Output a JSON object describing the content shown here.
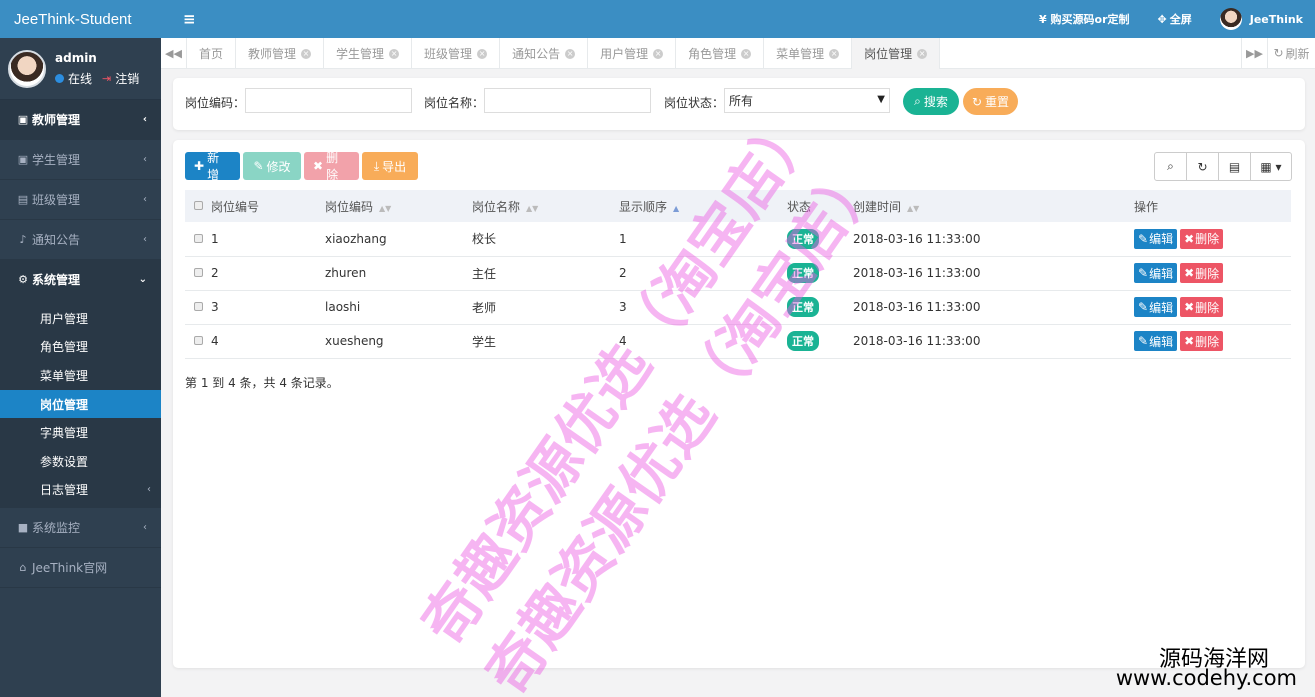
{
  "brand": "JeeThink-Student",
  "user": {
    "name": "admin",
    "status": "在线",
    "logout": "注销"
  },
  "sidebar": {
    "items": [
      {
        "label": "教师管理",
        "icon": "id-card-icon"
      },
      {
        "label": "学生管理",
        "icon": "id-card-icon"
      },
      {
        "label": "班级管理",
        "icon": "address-card-icon"
      },
      {
        "label": "通知公告",
        "icon": "bell-icon"
      },
      {
        "label": "系统管理",
        "icon": "gear-icon"
      }
    ],
    "submenu": [
      "用户管理",
      "角色管理",
      "菜单管理",
      "岗位管理",
      "字典管理",
      "参数设置",
      "日志管理"
    ],
    "monitor": "系统监控",
    "site": "JeeThink官网"
  },
  "topbar": {
    "buy": "¥ 购买源码or定制",
    "fullscreen": "全屏",
    "username": "JeeThink"
  },
  "tabs": [
    "首页",
    "教师管理",
    "学生管理",
    "班级管理",
    "通知公告",
    "用户管理",
    "角色管理",
    "菜单管理",
    "岗位管理"
  ],
  "refresh": "刷新",
  "search": {
    "code_label": "岗位编码：",
    "name_label": "岗位名称：",
    "status_label": "岗位状态：",
    "status_value": "所有",
    "search_btn": "搜索",
    "reset_btn": "重置"
  },
  "toolbar": {
    "add": "新增",
    "edit": "修改",
    "delete": "删除",
    "export": "导出"
  },
  "table": {
    "columns": [
      "岗位编号",
      "岗位编码",
      "岗位名称",
      "显示顺序",
      "状态",
      "创建时间",
      "操作"
    ],
    "rows": [
      {
        "id": "1",
        "code": "xiaozhang",
        "name": "校长",
        "order": "1",
        "status": "正常",
        "created": "2018-03-16 11:33:00"
      },
      {
        "id": "2",
        "code": "zhuren",
        "name": "主任",
        "order": "2",
        "status": "正常",
        "created": "2018-03-16 11:33:00"
      },
      {
        "id": "3",
        "code": "laoshi",
        "name": "老师",
        "order": "3",
        "status": "正常",
        "created": "2018-03-16 11:33:00"
      },
      {
        "id": "4",
        "code": "xuesheng",
        "name": "学生",
        "order": "4",
        "status": "正常",
        "created": "2018-03-16 11:33:00"
      }
    ],
    "edit_btn": "编辑",
    "delete_btn": "删除",
    "page_info": "第 1 到 4 条，共 4 条记录。"
  },
  "watermark": "奇趣资源优选（淘宝店）",
  "corner": {
    "line1": "源码海洋网",
    "line2": "www.codehy.com"
  },
  "colors": {
    "accent": "#3b8ec3",
    "sidebar": "#2f4050",
    "success": "#1ab394",
    "danger": "#ed5565",
    "warning": "#f8ac59",
    "primary": "#1c84c6"
  }
}
